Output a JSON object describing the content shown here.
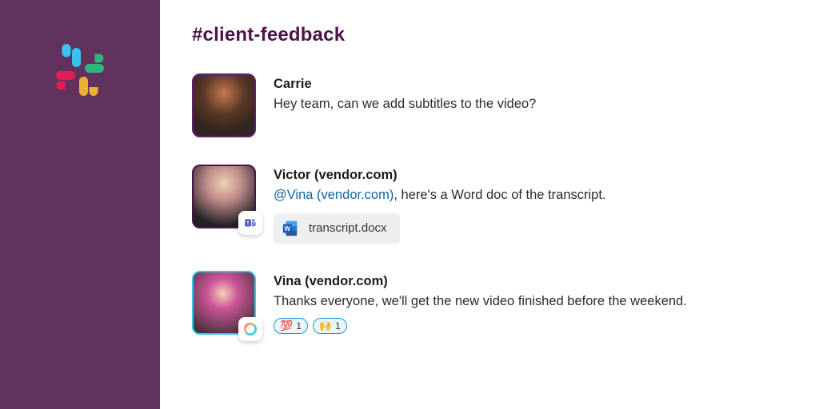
{
  "colors": {
    "sidebar": "#62325f",
    "channel_text": "#4b154a",
    "mention": "#1264a3",
    "reaction_border": "#1d9bd1"
  },
  "channel": {
    "name": "#client-feedback"
  },
  "messages": [
    {
      "user": "Carrie",
      "avatar_border": "#611f69",
      "text": "Hey team, can we add subtitles to the video?",
      "badge": null
    },
    {
      "user": "Victor (vendor.com)",
      "avatar_border": "#4a154b",
      "mention": "@Vina (vendor.com)",
      "text_after_mention": ", here's a Word doc of the transcript.",
      "badge": "teams-icon",
      "attachment": {
        "filename": "transcript.docx",
        "icon": "word-icon"
      }
    },
    {
      "user": "Vina (vendor.com)",
      "avatar_border": "#36c5f0",
      "text": "Thanks everyone, we'll get the new video finished before the weekend.",
      "badge": "rainbow-circle-icon",
      "reactions": [
        {
          "emoji": "💯",
          "count": 1
        },
        {
          "emoji": "🙌",
          "count": 1
        }
      ]
    }
  ]
}
